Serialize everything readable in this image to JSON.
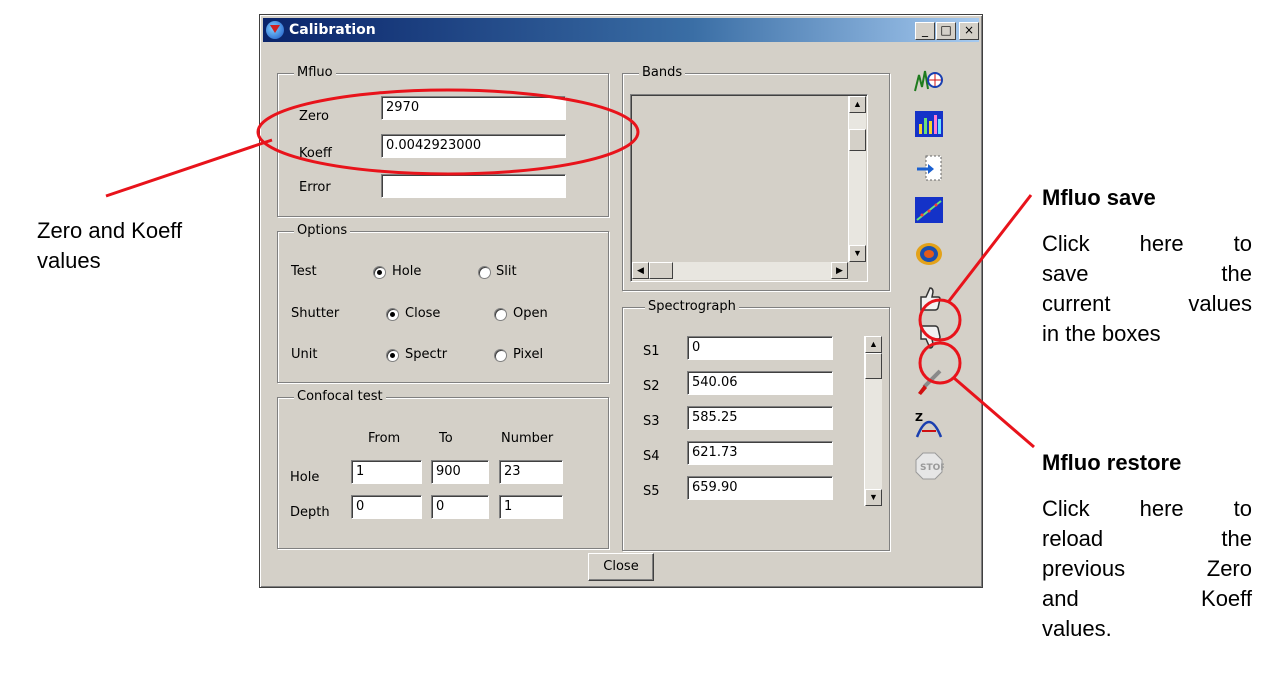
{
  "window": {
    "title": "Calibration",
    "minimize": "_",
    "maximize": "□",
    "close": "×"
  },
  "mfluo": {
    "legend": "Mfluo",
    "zero_label": "Zero",
    "zero_value": "2970",
    "koeff_label": "Koeff",
    "koeff_value": "0.0042923000",
    "error_label": "Error",
    "error_value": ""
  },
  "options": {
    "legend": "Options",
    "rows": [
      {
        "label": "Test",
        "opt1": "Hole",
        "opt2": "Slit",
        "selected": 1
      },
      {
        "label": "Shutter",
        "opt1": "Close",
        "opt2": "Open",
        "selected": 1
      },
      {
        "label": "Unit",
        "opt1": "Spectr",
        "opt2": "Pixel",
        "selected": 1
      }
    ]
  },
  "confocal": {
    "legend": "Confocal test",
    "headers": [
      "From",
      "To",
      "Number"
    ],
    "rows": [
      {
        "label": "Hole",
        "from": "1",
        "to": "900",
        "number": "23"
      },
      {
        "label": "Depth",
        "from": "0",
        "to": "0",
        "number": "1"
      }
    ]
  },
  "bands": {
    "legend": "Bands"
  },
  "spectrograph": {
    "legend": "Spectrograph",
    "rows": [
      {
        "label": "S1",
        "value": "0"
      },
      {
        "label": "S2",
        "value": "540.06"
      },
      {
        "label": "S3",
        "value": "585.25"
      },
      {
        "label": "S4",
        "value": "621.73"
      },
      {
        "label": "S5",
        "value": "659.90"
      }
    ]
  },
  "close_button": "Close",
  "toolbar_icons": [
    "spectrum-search-icon",
    "bar-chart-icon",
    "import-icon",
    "fit-line-icon",
    "hologram-icon",
    "thumbs-up-icon",
    "thumbs-down-icon",
    "brush-icon",
    "zero-peak-icon",
    "stop-icon"
  ],
  "annotations": {
    "left": {
      "line1": "Zero and Koeff",
      "line2": "values"
    },
    "save": {
      "title": "Mfluo save",
      "lines": [
        "Click here to",
        "save the",
        "current values",
        "in the boxes"
      ]
    },
    "restore": {
      "title": "Mfluo restore",
      "lines": [
        "Click here to",
        "reload the",
        "previous Zero",
        "and Koeff",
        "values."
      ]
    }
  },
  "colors": {
    "annotation_red": "#e8131b",
    "title_blue": "#0a246a"
  }
}
